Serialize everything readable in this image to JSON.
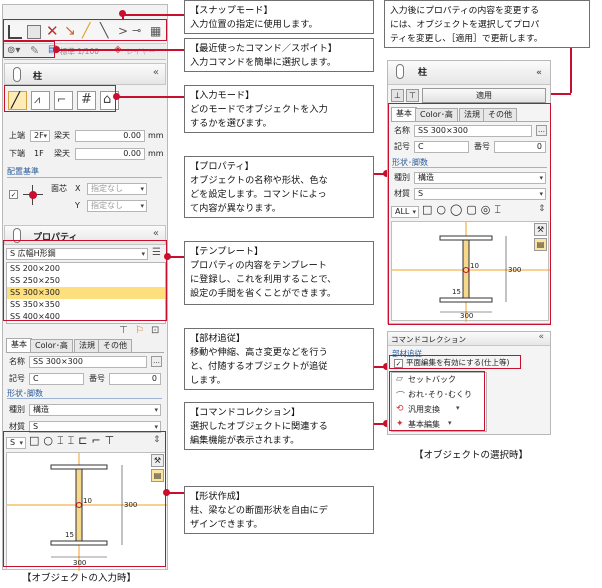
{
  "toolbar": {
    "scale_label": "標準 1/100",
    "layer_label": "レイヤー"
  },
  "left_panel": {
    "title": "柱",
    "upper_label": "上端",
    "upper_floor": "2F",
    "upper_ref": "梁天",
    "upper_value": "0.00",
    "lower_label": "下端",
    "lower_floor": "1F",
    "lower_ref": "梁天",
    "lower_value": "0.00",
    "unit": "mm",
    "placement_section": "配置基準",
    "face_label": "面芯",
    "x_label": "X",
    "y_label": "Y",
    "unspecified": "指定なし"
  },
  "property_panel": {
    "title": "プロパティ",
    "shape_type": "S 広幅H形鋼",
    "templates": [
      "SS 200×200",
      "SS 250×250",
      "SS 300×300",
      "SS 350×350",
      "SS 400×400"
    ],
    "selected_template": 2,
    "tabs": [
      "基本",
      "Color･高",
      "法規",
      "その他"
    ],
    "name_label": "名称",
    "name_value": "SS 300×300",
    "code_label": "記号",
    "code_value": "C",
    "number_label": "番号",
    "number_value": "0",
    "shape_section": "形状･脚数",
    "kind_label": "種別",
    "kind_value": "構造",
    "material_label": "材質",
    "material_value": "S",
    "shape_filter": "S",
    "dim_300": "300",
    "dim_15": "15",
    "dim_10": "10"
  },
  "right_panel": {
    "title": "柱",
    "apply_label": "適用",
    "tabs": [
      "基本",
      "Color･高",
      "法規",
      "その他"
    ],
    "name_label": "名称",
    "name_value": "SS 300×300",
    "code_label": "記号",
    "code_value": "C",
    "number_label": "番号",
    "number_value": "0",
    "shape_section": "形状･脚数",
    "kind_label": "種別",
    "kind_value": "構造",
    "material_label": "材質",
    "material_value": "S",
    "shape_filter": "ALL",
    "dim_300": "300",
    "dim_15": "15",
    "dim_10": "10"
  },
  "command_collection": {
    "title": "コマンドコレクション",
    "section": "部材追従",
    "checkbox_label": "平面編集を有効にする(仕上等)",
    "items": [
      "セットバック",
      "おれ･そり･むくり",
      "汎用変換",
      "基本編集"
    ]
  },
  "callouts": {
    "snap_title": "【スナップモード】",
    "snap_body": "入力位置の指定に使用します。",
    "recent_title": "【最近使ったコマンド／スポイト】",
    "recent_body": "入力コマンドを簡単に選択します。",
    "input_title": "【入力モード】",
    "input_body1": "どのモードでオブジェクトを入力",
    "input_body2": "するかを選びます。",
    "prop_title": "【プロパティ】",
    "prop_body1": "オブジェクトの名称や形状、色な",
    "prop_body2": "どを設定します。コマンドによっ",
    "prop_body3": "て内容が異なります。",
    "tmpl_title": "【テンプレート】",
    "tmpl_body1": "プロパティの内容をテンプレート",
    "tmpl_body2": "に登録し、これを利用することで、",
    "tmpl_body3": "設定の手間を省くことができます。",
    "follow_title": "【部材追従】",
    "follow_body1": "移動や伸縮、高さ変更などを行う",
    "follow_body2": "と、付随するオブジェクトが追従",
    "follow_body3": "します。",
    "cc_title": "【コマンドコレクション】",
    "cc_body1": "選択したオブジェクトに関連する",
    "cc_body2": "編集機能が表示されます。",
    "shape_title": "【形状作成】",
    "shape_body1": "柱、梁などの断面形状を自由にデ",
    "shape_body2": "ザインできます。",
    "top_right1": "入力後にプロパティの内容を変更する",
    "top_right2": "には、オブジェクトを選択してプロパ",
    "top_right3": "ティを変更し、［適用］で更新します。"
  },
  "captions": {
    "input_mode": "【オブジェクトの入力時】",
    "select_mode": "【オブジェクトの選択時】"
  }
}
